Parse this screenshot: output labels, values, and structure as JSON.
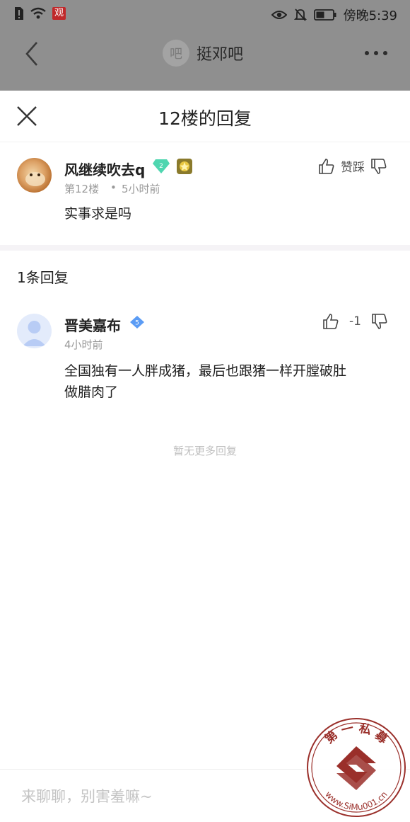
{
  "status_bar": {
    "time_text": "傍晚5:39",
    "carrier_badge": "观"
  },
  "nav": {
    "forum_avatar_text": "吧",
    "forum_name": "挺邓吧"
  },
  "sheet": {
    "title": "12楼的回复"
  },
  "main_post": {
    "username": "风继续吹去q",
    "level": "2",
    "floor": "第12楼",
    "dot": "•",
    "time": "5小时前",
    "content": "实事求是吗",
    "vote_label": "赞踩"
  },
  "replies_header": {
    "count_text": "1条回复"
  },
  "reply": {
    "username": "晋美嘉布",
    "level": "5",
    "time": "4小时前",
    "content_line1": "全国独有一人胖成猪，最后也跟猪一样开膛破肚",
    "content_line2": "做腊肉了",
    "score": "-1"
  },
  "no_more_text": "暂无更多回复",
  "input": {
    "placeholder": "来聊聊，别害羞嘛~"
  },
  "watermark": {
    "top_text": "第 一 私 募",
    "bottom_text": "www.SiMu001.cn"
  },
  "colors": {
    "accent_green": "#4fd6b0",
    "accent_blue": "#5b9cf5",
    "dim_overlay": "#8f8f8f",
    "stamp_red": "#9a2f2a"
  }
}
